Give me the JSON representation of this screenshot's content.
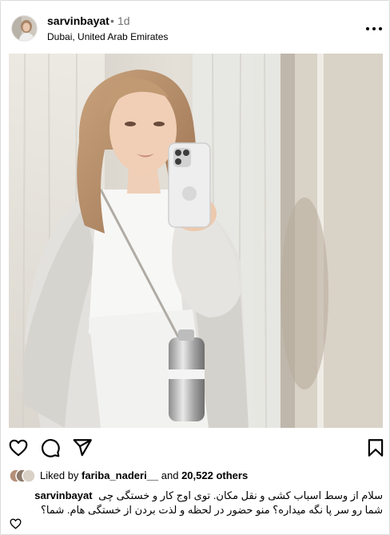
{
  "post": {
    "username": "sarvinbayat",
    "separator": "•",
    "time": "1d",
    "location": "Dubai, United Arab Emirates",
    "more_icon": "more-horizontal-icon"
  },
  "actions": {
    "like_icon": "heart-icon",
    "comment_icon": "comment-icon",
    "share_icon": "send-icon",
    "save_icon": "bookmark-icon"
  },
  "likes": {
    "prefix": "Liked by ",
    "user": "fariba_naderi__",
    "middle": " and ",
    "count": "20,522 others"
  },
  "caption": {
    "username": "sarvinbayat",
    "line1": "سلام از وسط اسباب کشی و نقل مکان. توی اوج کار و خستگی چی",
    "line2": "شما رو سر پا نگه میداره؟ منو حضور در لحظه و لذت بردن از خستگی هام. شما؟"
  }
}
